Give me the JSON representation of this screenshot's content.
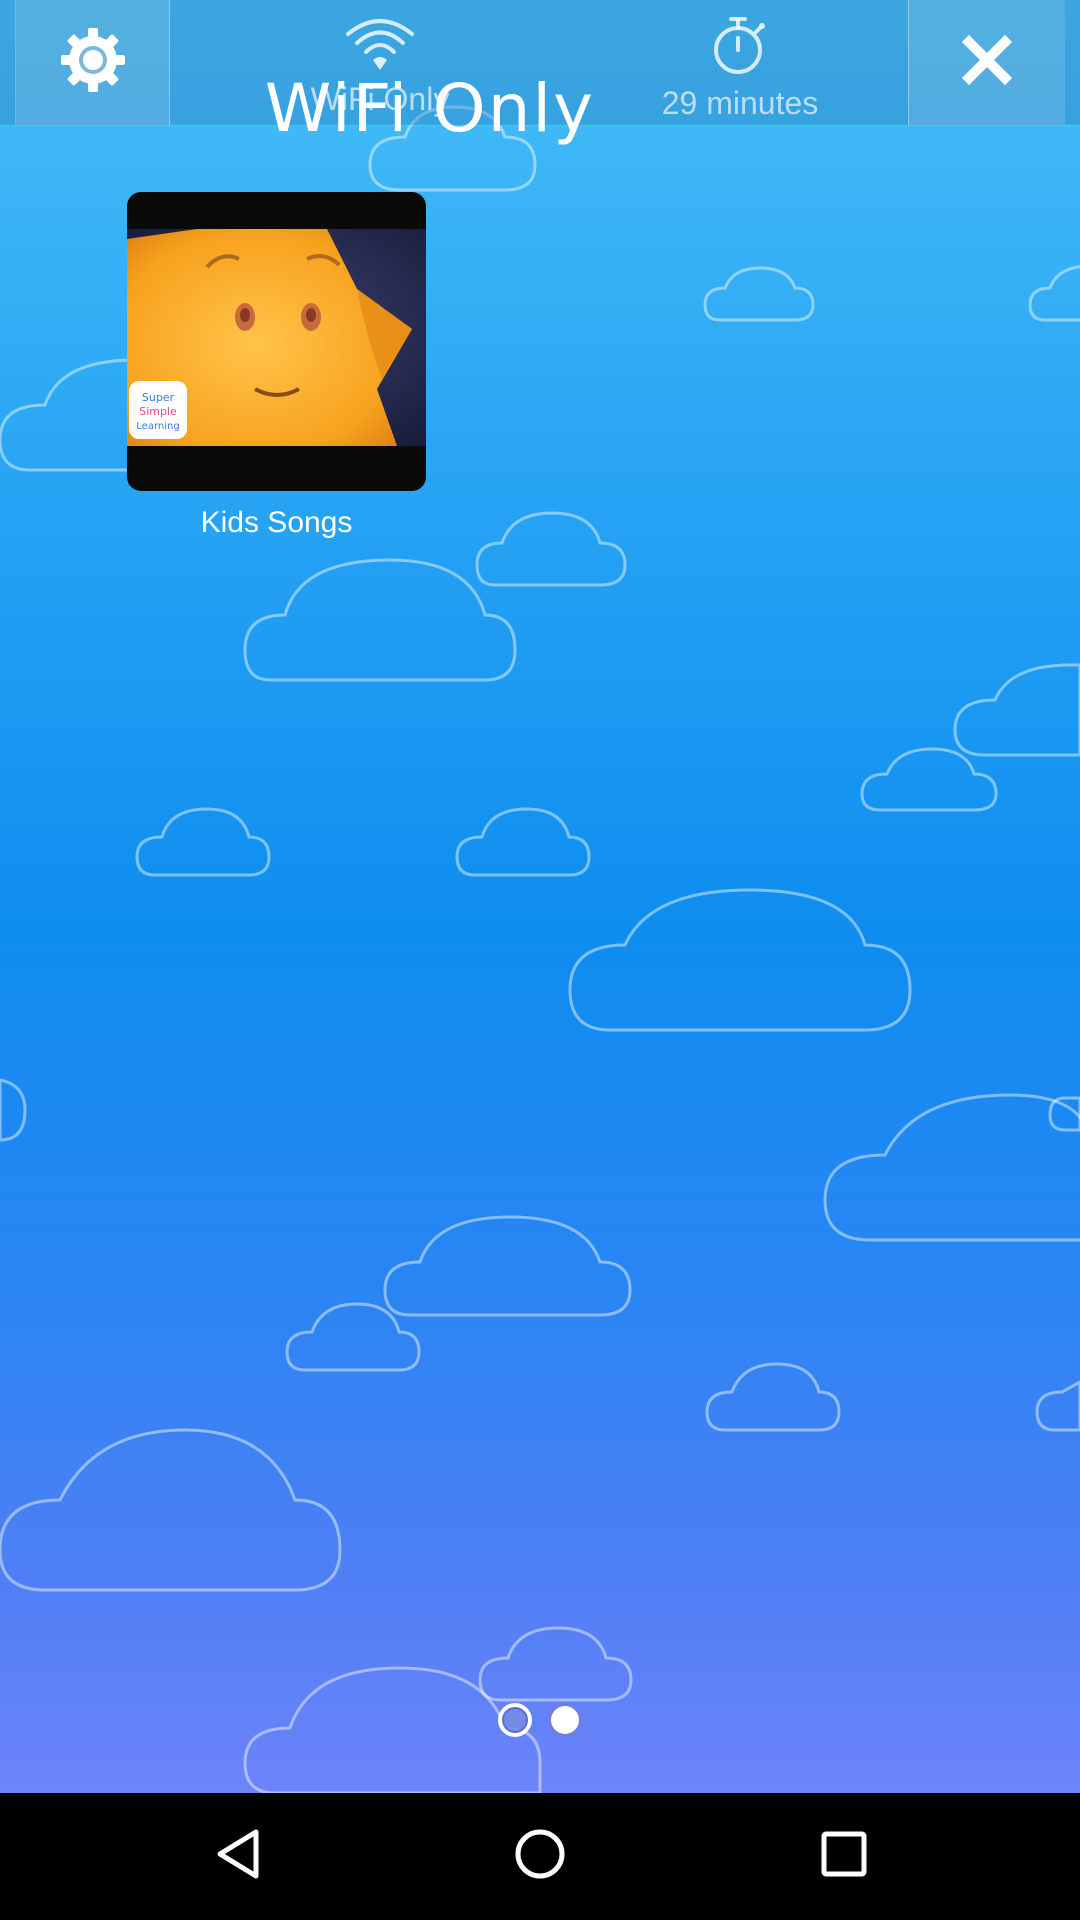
{
  "toolbar": {
    "settings_icon": "gear-icon",
    "wifi": {
      "icon": "wifi-icon",
      "label": "WiFi Only",
      "overlay_text": "WiFi Only"
    },
    "timer": {
      "icon": "stopwatch-icon",
      "label": "29 minutes"
    },
    "close_icon": "close-icon"
  },
  "content": {
    "tiles": [
      {
        "label": "Kids Songs",
        "thumbnail_badge": "Super Simple Learning"
      }
    ]
  },
  "pager": {
    "pages": 2,
    "current_page": 2
  },
  "navbar": {
    "back_icon": "back-triangle-icon",
    "home_icon": "home-circle-icon",
    "recents_icon": "recents-square-icon"
  },
  "colors": {
    "sky_top": "#47bff8",
    "sky_mid": "#0e8df0",
    "sky_bottom": "#6d84fa",
    "text": "#ffffff",
    "navbar": "#000000"
  }
}
